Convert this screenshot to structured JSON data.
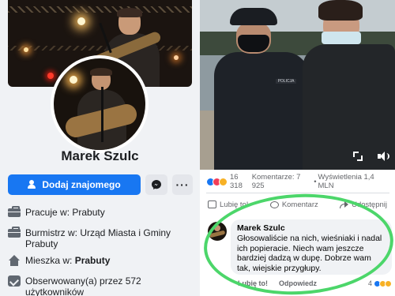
{
  "profile": {
    "name": "Marek Szulc",
    "add_friend_label": "Dodaj znajomego",
    "more_label": "···",
    "info": [
      {
        "prefix": "Pracuje w: ",
        "value": "Prabuty",
        "icon": "briefcase-icon"
      },
      {
        "prefix": "Burmistrz w: ",
        "value": "Urząd Miasta i Gminy Prabuty",
        "icon": "briefcase-icon"
      },
      {
        "prefix": "Mieszka w: ",
        "value": "Prabuty",
        "icon": "home-icon"
      },
      {
        "prefix": "Obserwowany(a) przez 572 użytkowników",
        "value": "",
        "icon": "followers-icon"
      }
    ]
  },
  "post": {
    "video_badge": "POLICJA",
    "reaction_count": "16 318",
    "comments": "Komentarze: 7 925",
    "views": "Wyświetlenia 1,4 MLN",
    "separator": "•",
    "actions": {
      "like": "Lubię to!",
      "comment": "Komentarz",
      "share": "Udostępnij"
    }
  },
  "comment": {
    "author": "Marek Szulc",
    "text": "Głosowaliście na nich, wieśniaki i nadal ich popieracie. Niech wam jeszcze bardziej dadzą w dupę. Dobrze wam tak, wiejskie przygłupy.",
    "like_label": "Lubię to!",
    "reply_label": "Odpowiedz",
    "reaction_count": "4"
  },
  "colors": {
    "brand_blue": "#1877f2",
    "highlight_green": "#4cd66a"
  }
}
